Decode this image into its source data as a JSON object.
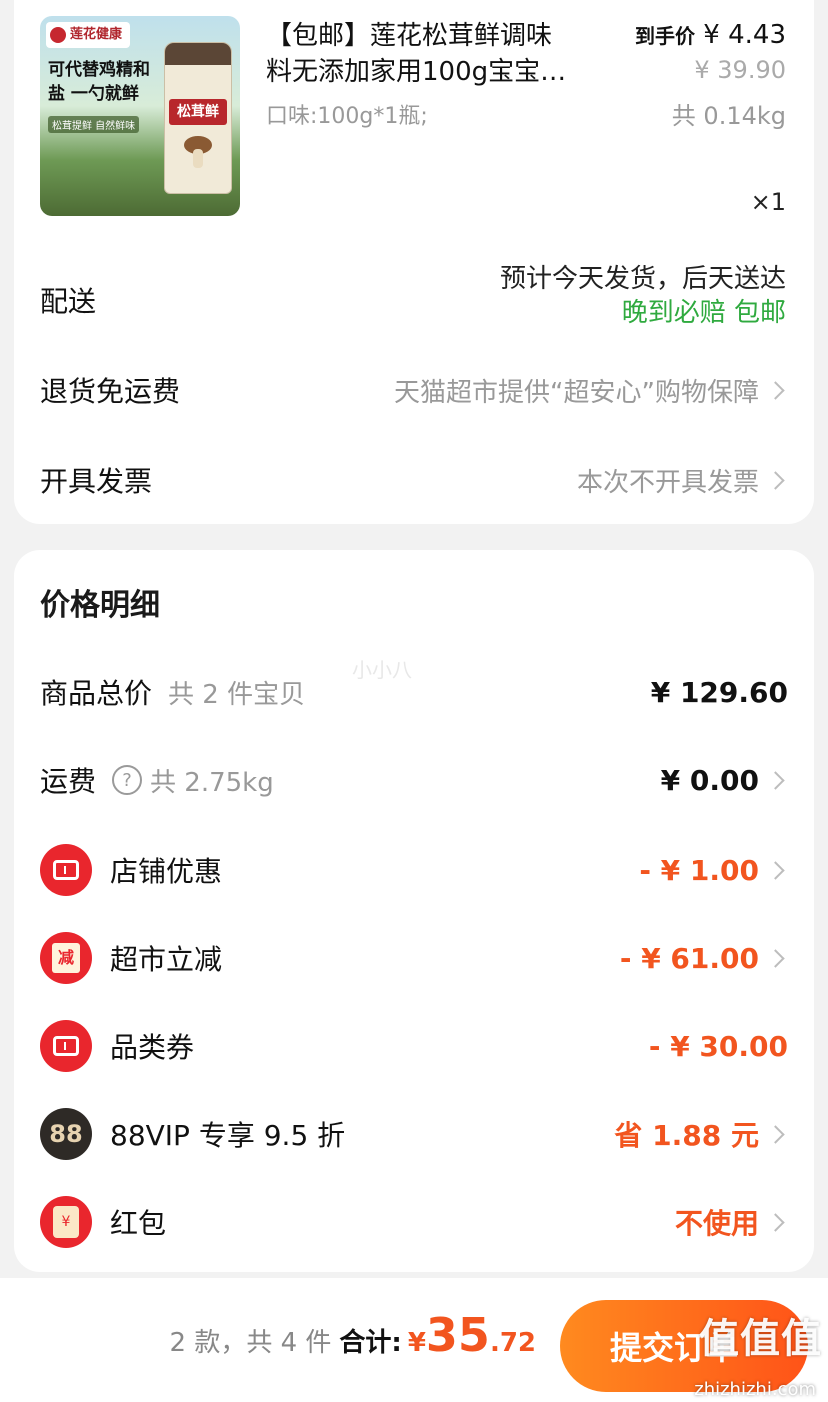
{
  "product": {
    "title_line1": "【包邮】莲花松茸鲜调味",
    "title_line2": "料无添加家用100g宝宝…",
    "spec": "口味:100g*1瓶;",
    "final_price_label": "到手价",
    "final_price": "¥ 4.43",
    "original_price": "¥ 39.90",
    "weight": "共 0.14kg",
    "quantity": "×1",
    "image_brand": "莲花健康",
    "image_slogan": "可代替鸡精和盐 一勺就鲜",
    "image_sub": "松茸提鲜 自然鲜味",
    "image_jar_label": "松茸鲜"
  },
  "delivery": {
    "label": "配送",
    "estimate": "预计今天发货，后天送达",
    "guarantee": "晚到必赔 包邮"
  },
  "return_shipping": {
    "label": "退货免运费",
    "value": "天猫超市提供“超安心”购物保障"
  },
  "invoice": {
    "label": "开具发票",
    "value": "本次不开具发票"
  },
  "price_detail": {
    "title": "价格明细",
    "watermark": "小小八",
    "goods_total": {
      "label": "商品总价",
      "note": "共 2 件宝贝",
      "value": "¥ 129.60"
    },
    "shipping": {
      "label": "运费",
      "note": "共 2.75kg",
      "value": "¥ 0.00"
    },
    "store_discount": {
      "label": "店铺优惠",
      "value": "- ¥ 1.00"
    },
    "supermarket_discount": {
      "label": "超市立减",
      "icon_text": "减",
      "value": "- ¥ 61.00"
    },
    "category_coupon": {
      "label": "品类券",
      "value": "- ¥ 30.00"
    },
    "vip": {
      "label": "88VIP 专享 9.5 折",
      "icon_text": "88",
      "value": "省 1.88 元"
    },
    "red_packet": {
      "label": "红包",
      "icon_text": "¥",
      "value": "不使用"
    }
  },
  "bottom": {
    "count": "2 款，共 4 件",
    "total_label": "合计:",
    "currency": "¥",
    "amount_int": "35",
    "amount_dec": ".72",
    "submit": "提交订单",
    "site_logo": "值值值",
    "site_url": "zhizhizhi.com"
  },
  "colors": {
    "accent": "#f2551f",
    "green": "#2faa3f",
    "coupon_red": "#e9262d"
  }
}
